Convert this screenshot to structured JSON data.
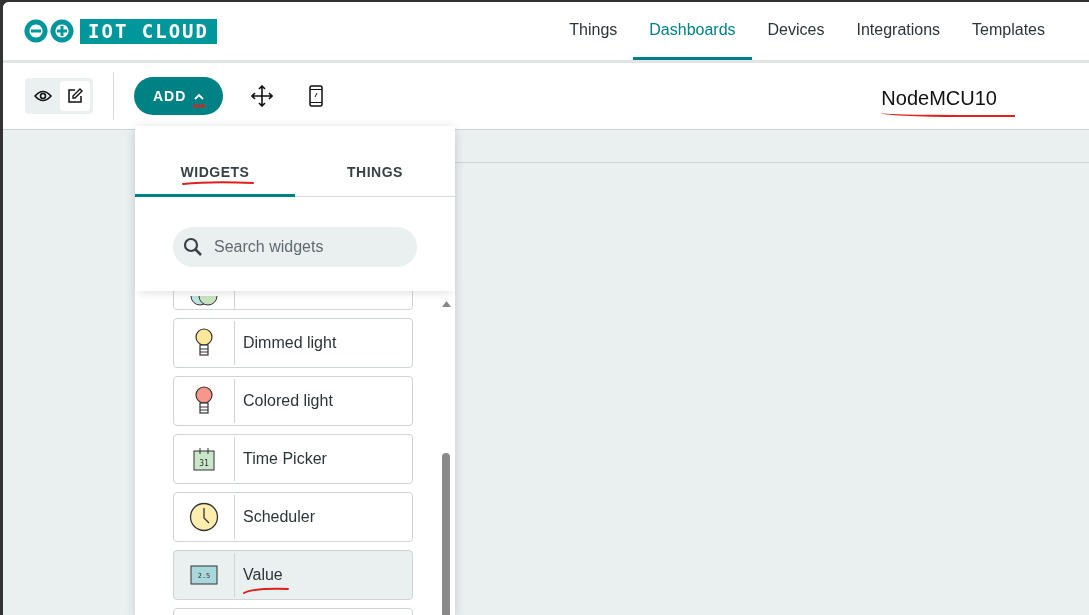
{
  "logo": {
    "text": "IOT CLOUD"
  },
  "nav": [
    {
      "label": "Things",
      "selected": false
    },
    {
      "label": "Dashboards",
      "selected": true
    },
    {
      "label": "Devices",
      "selected": false
    },
    {
      "label": "Integrations",
      "selected": false
    },
    {
      "label": "Templates",
      "selected": false
    }
  ],
  "toolbar": {
    "modes": [
      {
        "kind": "view",
        "selected": false
      },
      {
        "kind": "edit",
        "selected": true
      }
    ],
    "add_button": {
      "label": "ADD",
      "underlined": true
    },
    "dashboard_name": {
      "text": "NodeMCU10",
      "underlined": true
    }
  },
  "panel": {
    "tabs": [
      {
        "label": "WIDGETS",
        "selected": true,
        "underlined": true
      },
      {
        "label": "THINGS",
        "selected": false,
        "underlined": false
      }
    ],
    "search": {
      "placeholder": "Search widgets"
    },
    "widgets": [
      {
        "kind": "swatch",
        "selected": false
      },
      {
        "kind": "dimmer",
        "label": "Dimmed light",
        "selected": false,
        "underlined": false
      },
      {
        "kind": "colored",
        "label": "Colored light",
        "selected": false,
        "underlined": false
      },
      {
        "kind": "calendar",
        "label": "Time Picker",
        "icon_text": "31",
        "selected": false,
        "underlined": false
      },
      {
        "kind": "clock",
        "label": "Scheduler",
        "selected": false,
        "underlined": false
      },
      {
        "kind": "display",
        "label": "Value",
        "icon_text": "2.5",
        "selected": true,
        "underlined": true
      },
      {
        "kind": "blank",
        "selected": false
      }
    ]
  }
}
